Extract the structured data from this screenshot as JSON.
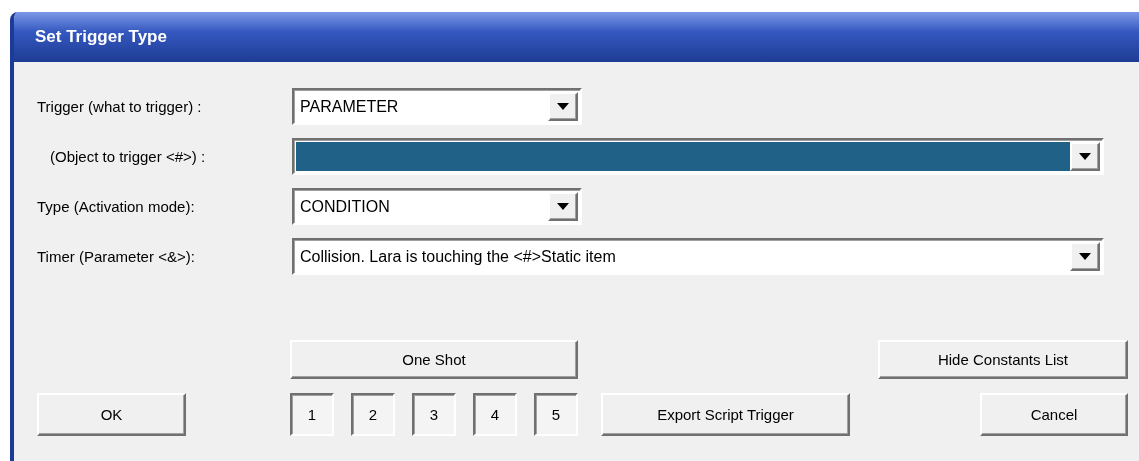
{
  "window": {
    "title": "Set Trigger Type"
  },
  "fields": [
    {
      "label": "Trigger (what to trigger) :",
      "value": "PARAMETER",
      "highlighted": false
    },
    {
      "label": "(Object to trigger <#>) :",
      "highlighted": true
    },
    {
      "label": "Type (Activation mode):",
      "value": "CONDITION",
      "highlighted": false
    },
    {
      "label": "Timer (Parameter <&>):",
      "value": "Collision. Lara is touching the <#>Static item",
      "highlighted": false
    }
  ],
  "buttons": {
    "one_shot": "One Shot",
    "hide_constants": "Hide Constants List",
    "ok": "OK",
    "export": "Export Script Trigger",
    "cancel": "Cancel"
  },
  "flags": [
    {
      "label": "1",
      "pressed": true
    },
    {
      "label": "2",
      "pressed": true
    },
    {
      "label": "3",
      "pressed": true
    },
    {
      "label": "4",
      "pressed": true
    },
    {
      "label": "5",
      "pressed": true
    }
  ]
}
